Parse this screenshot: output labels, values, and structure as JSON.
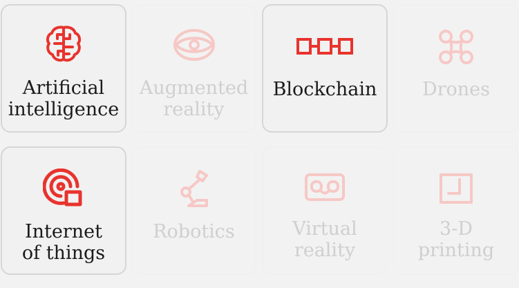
{
  "tiles": [
    {
      "label": "Artificial intelligence",
      "icon": "brain-circuit-icon",
      "active": true
    },
    {
      "label": "Augmented reality",
      "icon": "eye-icon",
      "active": false
    },
    {
      "label": "Blockchain",
      "icon": "chain-blocks-icon",
      "active": true
    },
    {
      "label": "Drones",
      "icon": "drone-icon",
      "active": false
    },
    {
      "label": "Internet of things",
      "icon": "signal-device-icon",
      "active": true
    },
    {
      "label": "Robotics",
      "icon": "robot-arm-icon",
      "active": false
    },
    {
      "label": "Virtual reality",
      "icon": "vr-headset-icon",
      "active": false
    },
    {
      "label": "3-D printing",
      "icon": "3d-printer-icon",
      "active": false
    }
  ],
  "colors": {
    "accent": "#e8332d",
    "accent_faded": "#f6c8c5",
    "text": "#1a1a1a",
    "text_faded": "#cfcfcf"
  }
}
